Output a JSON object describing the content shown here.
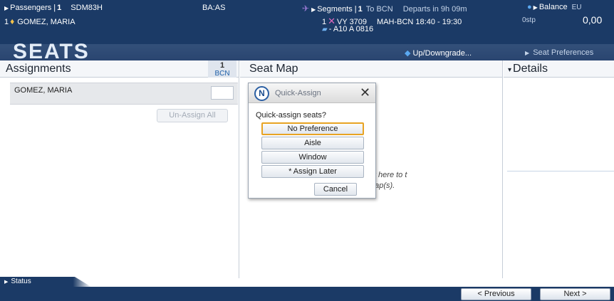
{
  "header": {
    "passengers_label": "Passengers |",
    "passengers_count": "1",
    "record_locator": "SDM83H",
    "airline_codes": "BA:AS",
    "pax_index": "1",
    "pax_name": "GOMEZ, MARIA",
    "segments_label": "Segments |",
    "segments_count": "1",
    "segments_to": "To BCN",
    "departs": "Departs in 9h 09m",
    "flight_index": "1",
    "flight_number": "VY 3709",
    "route_time": "MAH-BCN  18:40 - 19:30",
    "aircraft": "- A10 A 0816",
    "balance_label": "Balance",
    "balance_currency": "EU",
    "balance_detail": "0stp",
    "balance_amount": "0,00"
  },
  "banner": {
    "title": "SEATS",
    "upgrade_label": "Up/Downgrade...",
    "seat_preferences_label": "Seat Preferences"
  },
  "assignments": {
    "title": "Assignments",
    "flight_col_num": "1",
    "flight_col_code": "BCN",
    "passenger_name": "GOMEZ, MARIA",
    "unassign_all_label": "Un-Assign All"
  },
  "seat_map": {
    "title": "Seat Map",
    "hint_text": "ck here to t map(s)."
  },
  "details": {
    "title": "Details"
  },
  "quick_assign": {
    "title": "Quick-Assign",
    "question": "Quick-assign seats?",
    "no_preference": "No Preference",
    "aisle": "Aisle",
    "window": "Window",
    "assign_later": "* Assign Later",
    "cancel": "Cancel"
  },
  "footer": {
    "status_label": "Status",
    "previous_label": "< Previous",
    "next_label": "Next >"
  },
  "colors": {
    "header_bg": "#1b3a66",
    "focus_outline": "#e8a323",
    "link_blue": "#1d5fa8"
  }
}
